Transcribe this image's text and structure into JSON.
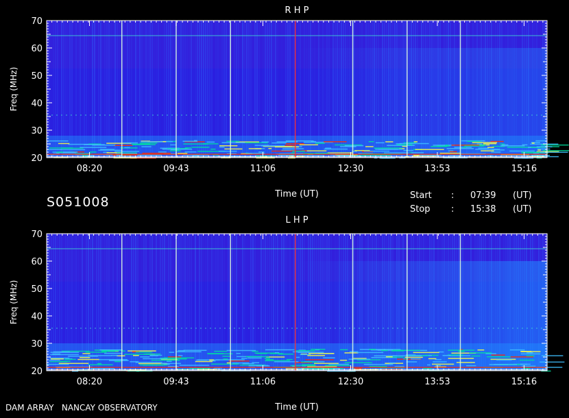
{
  "header": {
    "station": "S051008",
    "start_label": "Start",
    "start_sep": ":",
    "start_time": "07:39",
    "start_unit": "(UT)",
    "stop_label": "Stop",
    "stop_sep": ":",
    "stop_time": "15:38",
    "stop_unit": "(UT)"
  },
  "footer": {
    "credit": "DAM ARRAY   NANCAY OBSERVATORY"
  },
  "chart_data": [
    {
      "type": "heatmap",
      "title": "R H P",
      "xlabel": "Time (UT)",
      "ylabel": "Freq (MHz)",
      "xlim": [
        "07:39",
        "15:38"
      ],
      "ylim": [
        20,
        70
      ],
      "x_ticks": [
        "08:20",
        "09:43",
        "11:06",
        "12:30",
        "13:53",
        "15:16"
      ],
      "y_ticks": [
        20,
        30,
        40,
        50,
        60,
        70
      ],
      "colors": {
        "background": "#2a1fe0",
        "low": "#1a12c8",
        "mid": "#1e90ff",
        "high": "#00e0a0",
        "peak": "#ff2a00"
      },
      "features": {
        "vertical_lines_ut": [
          "08:51",
          "09:43",
          "10:35",
          "11:37",
          "12:32",
          "13:24",
          "14:15"
        ],
        "horizontal_lines_mhz": [
          64.5,
          35.5
        ],
        "strong_emission_mhz": [
          20,
          28
        ]
      }
    },
    {
      "type": "heatmap",
      "title": "L H P",
      "xlabel": "Time (UT)",
      "ylabel": "Freq (MHz)",
      "xlim": [
        "07:39",
        "15:38"
      ],
      "ylim": [
        20,
        70
      ],
      "x_ticks": [
        "08:20",
        "09:43",
        "11:06",
        "12:30",
        "13:53",
        "15:16"
      ],
      "y_ticks": [
        20,
        30,
        40,
        50,
        60,
        70
      ],
      "colors": {
        "background": "#2a1fe0",
        "low": "#1a12c8",
        "mid": "#1e90ff",
        "high": "#00e0a0",
        "peak": "#ff2a00"
      },
      "features": {
        "vertical_lines_ut": [
          "08:51",
          "09:43",
          "10:35",
          "11:37",
          "12:32",
          "13:24",
          "14:15"
        ],
        "horizontal_lines_mhz": [
          64.5,
          35.5
        ],
        "strong_emission_mhz": [
          20,
          30
        ]
      }
    }
  ]
}
